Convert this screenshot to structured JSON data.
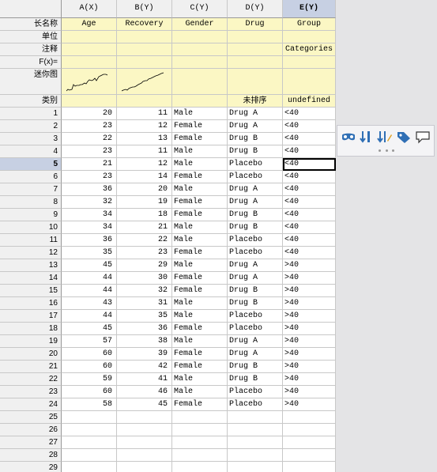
{
  "column_headers": [
    "A(X)",
    "B(Y)",
    "C(Y)",
    "D(Y)",
    "E(Y)"
  ],
  "meta_labels": {
    "long_name": "长名称",
    "units": "单位",
    "comments": "注释",
    "formula": "F(x)=",
    "sparkline": "迷你图",
    "category": "类别"
  },
  "long_names": [
    "Age",
    "Recovery",
    "Gender",
    "Drug",
    "Group"
  ],
  "comments": [
    "",
    "",
    "",
    "",
    "Categories"
  ],
  "category_row": [
    "",
    "",
    "",
    "未排序",
    "undefined"
  ],
  "rows": [
    {
      "n": "1",
      "a": "20",
      "b": "11",
      "c": "Male",
      "d": "Drug A",
      "e": "<40"
    },
    {
      "n": "2",
      "a": "23",
      "b": "12",
      "c": "Female",
      "d": "Drug A",
      "e": "<40"
    },
    {
      "n": "3",
      "a": "22",
      "b": "13",
      "c": "Female",
      "d": "Drug B",
      "e": "<40"
    },
    {
      "n": "4",
      "a": "23",
      "b": "11",
      "c": "Male",
      "d": "Drug B",
      "e": "<40"
    },
    {
      "n": "5",
      "a": "21",
      "b": "12",
      "c": "Male",
      "d": "Placebo",
      "e": "<40"
    },
    {
      "n": "6",
      "a": "23",
      "b": "14",
      "c": "Female",
      "d": "Placebo",
      "e": "<40"
    },
    {
      "n": "7",
      "a": "36",
      "b": "20",
      "c": "Male",
      "d": "Drug A",
      "e": "<40"
    },
    {
      "n": "8",
      "a": "32",
      "b": "19",
      "c": "Female",
      "d": "Drug A",
      "e": "<40"
    },
    {
      "n": "9",
      "a": "34",
      "b": "18",
      "c": "Female",
      "d": "Drug B",
      "e": "<40"
    },
    {
      "n": "10",
      "a": "34",
      "b": "21",
      "c": "Male",
      "d": "Drug B",
      "e": "<40"
    },
    {
      "n": "11",
      "a": "36",
      "b": "22",
      "c": "Male",
      "d": "Placebo",
      "e": "<40"
    },
    {
      "n": "12",
      "a": "35",
      "b": "23",
      "c": "Female",
      "d": "Placebo",
      "e": "<40"
    },
    {
      "n": "13",
      "a": "45",
      "b": "29",
      "c": "Male",
      "d": "Drug A",
      "e": ">40"
    },
    {
      "n": "14",
      "a": "44",
      "b": "30",
      "c": "Female",
      "d": "Drug A",
      "e": ">40"
    },
    {
      "n": "15",
      "a": "44",
      "b": "32",
      "c": "Female",
      "d": "Drug B",
      "e": ">40"
    },
    {
      "n": "16",
      "a": "43",
      "b": "31",
      "c": "Male",
      "d": "Drug B",
      "e": ">40"
    },
    {
      "n": "17",
      "a": "44",
      "b": "35",
      "c": "Male",
      "d": "Placebo",
      "e": ">40"
    },
    {
      "n": "18",
      "a": "45",
      "b": "36",
      "c": "Female",
      "d": "Placebo",
      "e": ">40"
    },
    {
      "n": "19",
      "a": "57",
      "b": "38",
      "c": "Male",
      "d": "Drug A",
      "e": ">40"
    },
    {
      "n": "20",
      "a": "60",
      "b": "39",
      "c": "Female",
      "d": "Drug A",
      "e": ">40"
    },
    {
      "n": "21",
      "a": "60",
      "b": "42",
      "c": "Female",
      "d": "Drug B",
      "e": ">40"
    },
    {
      "n": "22",
      "a": "59",
      "b": "41",
      "c": "Male",
      "d": "Drug B",
      "e": ">40"
    },
    {
      "n": "23",
      "a": "60",
      "b": "46",
      "c": "Male",
      "d": "Placebo",
      "e": ">40"
    },
    {
      "n": "24",
      "a": "58",
      "b": "45",
      "c": "Female",
      "d": "Placebo",
      "e": ">40"
    },
    {
      "n": "25",
      "a": "",
      "b": "",
      "c": "",
      "d": "",
      "e": ""
    },
    {
      "n": "26",
      "a": "",
      "b": "",
      "c": "",
      "d": "",
      "e": ""
    },
    {
      "n": "27",
      "a": "",
      "b": "",
      "c": "",
      "d": "",
      "e": ""
    },
    {
      "n": "28",
      "a": "",
      "b": "",
      "c": "",
      "d": "",
      "e": ""
    },
    {
      "n": "29",
      "a": "",
      "b": "",
      "c": "",
      "d": "",
      "e": ""
    }
  ],
  "selected_column": "E(Y)",
  "active_row": "5",
  "toolbar": {
    "icons": [
      "mask-icon",
      "sort-icon",
      "sort-custom-icon",
      "tag-icon",
      "comment-icon"
    ]
  },
  "colors": {
    "meta_background": "#fbf7c4",
    "selected_header": "#c7d0e3",
    "icon_blue": "#2f6fb5"
  }
}
